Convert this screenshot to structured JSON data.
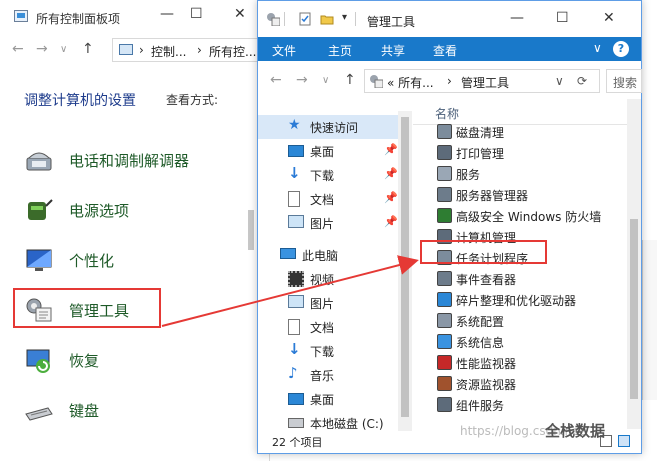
{
  "control_panel": {
    "title": "所有控制面板项",
    "breadcrumb": [
      "控制...",
      "所有控..."
    ],
    "heading": "调整计算机的设置",
    "view_label": "查看方式:",
    "items": [
      {
        "label": "电话和调制解调器",
        "icon": "phone-modem-icon"
      },
      {
        "label": "电源选项",
        "icon": "power-options-icon"
      },
      {
        "label": "个性化",
        "icon": "personalization-icon"
      },
      {
        "label": "管理工具",
        "icon": "admin-tools-icon"
      },
      {
        "label": "恢复",
        "icon": "recovery-icon"
      },
      {
        "label": "键盘",
        "icon": "keyboard-icon"
      }
    ]
  },
  "explorer": {
    "title": "管理工具",
    "ribbon_tabs": [
      "文件",
      "主页",
      "共享",
      "查看"
    ],
    "breadcrumb": [
      "« 所有...",
      "管理工具"
    ],
    "search_placeholder": "搜索",
    "column_header": "名称",
    "nav": [
      {
        "label": "快速访问",
        "icon": "star-icon",
        "pinned": false,
        "selected": true
      },
      {
        "label": "桌面",
        "icon": "desktop-icon",
        "pinned": true
      },
      {
        "label": "下载",
        "icon": "download-icon",
        "pinned": true
      },
      {
        "label": "文档",
        "icon": "documents-icon",
        "pinned": true
      },
      {
        "label": "图片",
        "icon": "pictures-icon",
        "pinned": true
      },
      {
        "label": "此电脑",
        "icon": "this-pc-icon",
        "pinned": false
      },
      {
        "label": "视频",
        "icon": "videos-icon",
        "pinned": false
      },
      {
        "label": "图片",
        "icon": "pictures-icon",
        "pinned": false
      },
      {
        "label": "文档",
        "icon": "documents-icon",
        "pinned": false
      },
      {
        "label": "下载",
        "icon": "download-icon",
        "pinned": false
      },
      {
        "label": "音乐",
        "icon": "music-icon",
        "pinned": false
      },
      {
        "label": "桌面",
        "icon": "desktop-icon",
        "pinned": false
      },
      {
        "label": "本地磁盘 (C:)",
        "icon": "disk-icon",
        "pinned": false
      }
    ],
    "files": [
      "磁盘清理",
      "打印管理",
      "服务",
      "服务器管理器",
      "高级安全 Windows 防火墙",
      "计算机管理",
      "任务计划程序",
      "事件查看器",
      "碎片整理和优化驱动器",
      "系统配置",
      "系统信息",
      "性能监视器",
      "资源监视器",
      "组件服务"
    ],
    "status_count": "22 个项目"
  },
  "watermark": "https://blog.csdn.net/",
  "wechat_label": "全栈数据",
  "colors": {
    "accent": "#1979ca",
    "highlight": "#e53935",
    "link": "#1e5a28"
  }
}
